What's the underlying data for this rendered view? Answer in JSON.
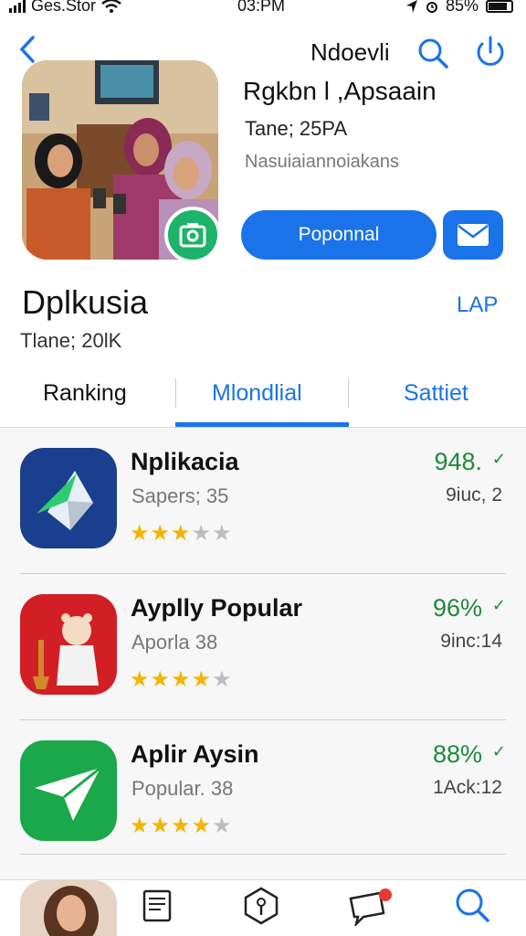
{
  "status": {
    "carrier": "Ges.Stor",
    "time": "03:PM",
    "battery": "85%"
  },
  "header": {
    "title": "Ndoevli"
  },
  "hero": {
    "title": "Rgkbn l ,Apsaain",
    "subtitle": "Tane; 25PA",
    "description": "Nasuiaiannoiakans",
    "primary_button": "Poponnal"
  },
  "section": {
    "title": "Dplkusia",
    "link": "LAP",
    "subtitle": "Tlane; 20lK"
  },
  "tabs": [
    "Ranking",
    "Mlondlial",
    "Sattiet"
  ],
  "active_tab": 1,
  "apps": [
    {
      "name": "Nplikacia",
      "sub": "Sapers; 35",
      "percent": "948.",
      "meta": "9iuc, 2",
      "rating": 2.5,
      "icon": "crystal-app-icon",
      "color": "#1b3f8f"
    },
    {
      "name": "Ayplly Popular",
      "sub": "Aporla 38",
      "percent": "96%",
      "meta": "9inc:14",
      "rating": 3.5,
      "icon": "bear-app-icon",
      "color": "#d21f26"
    },
    {
      "name": "Aplir Aysin",
      "sub": "Popular. 38",
      "percent": "88%",
      "meta": "1Ack:12",
      "rating": 4,
      "icon": "paper-plane-app-icon",
      "color": "#1aa84a"
    }
  ],
  "colors": {
    "accent": "#1a73e8",
    "success": "#1e8a3a",
    "star": "#f4b400"
  }
}
